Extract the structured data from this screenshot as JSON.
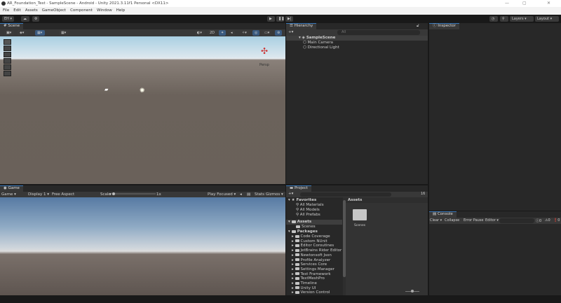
{
  "window": {
    "title": "AR_Foundation_Test - SampleScene - Android - Unity 2021.3.11f1 Personal <DX11>",
    "minimize": "—",
    "maximize": "▢",
    "close": "✕"
  },
  "menu": [
    "File",
    "Edit",
    "Assets",
    "GameObject",
    "Component",
    "Window",
    "Help"
  ],
  "toolbar": {
    "account": "EH ▾",
    "layers": "Layers",
    "layout": "Layout"
  },
  "scene": {
    "tab": "Scene",
    "mode2d": "2D",
    "persp": "Persp"
  },
  "game": {
    "tab": "Game",
    "display_mode": "Game",
    "display": "Display 1",
    "aspect": "Free Aspect",
    "scale_label": "Scale",
    "scale_value": "1x",
    "play_mode": "Play Focused",
    "stats": "Stats",
    "gizmos": "Gizmos"
  },
  "hierarchy": {
    "tab": "Hierarchy",
    "search_placeholder": "All",
    "scene": "SampleScene",
    "objects": [
      "Main Camera",
      "Directional Light"
    ]
  },
  "inspector": {
    "tab": "Inspector"
  },
  "project": {
    "tab": "Project",
    "count": "16",
    "favorites": {
      "label": "Favorites",
      "items": [
        "All Materials",
        "All Models",
        "All Prefabs"
      ]
    },
    "assets": {
      "label": "Assets",
      "items": [
        "Scenes"
      ]
    },
    "packages": {
      "label": "Packages",
      "items": [
        "Code Coverage",
        "Custom NUnit",
        "Editor Coroutines",
        "JetBrains Rider Editor",
        "Newtonsoft Json",
        "Profile Analyzer",
        "Services Core",
        "Settings Manager",
        "Test Framework",
        "TextMeshPro",
        "Timeline",
        "Unity UI",
        "Version Control"
      ]
    },
    "breadcrumb": "Assets",
    "grid_items": [
      "Scenes"
    ]
  },
  "console": {
    "tab": "Console",
    "clear": "Clear",
    "collapse": "Collapse",
    "error_pause": "Error Pause",
    "editor": "Editor ▾",
    "log_count": "0",
    "warn_count": "0",
    "error_count": "0"
  }
}
